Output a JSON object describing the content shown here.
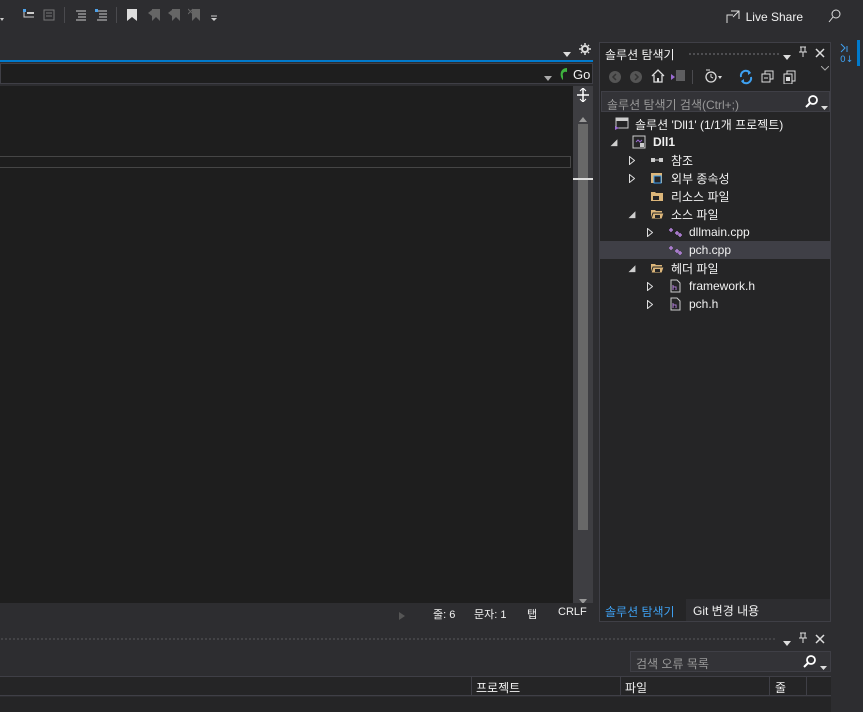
{
  "toolbar": {
    "live_share_label": "Live Share",
    "accent_color": "#007acc"
  },
  "editor": {
    "nav_go_label": "Go",
    "status": {
      "line": "줄: 6",
      "char": "문자: 1",
      "tab": "탭",
      "eol": "CRLF"
    }
  },
  "solution_explorer": {
    "title": "솔루션 탐색기",
    "search_placeholder": "솔루션 탐색기 검색(Ctrl+;)",
    "tree": [
      {
        "label": "솔루션 'Dll1' (1/1개 프로젝트)",
        "icon": "solution-icon",
        "expander": "none",
        "depth": 0
      },
      {
        "label": "Dll1",
        "icon": "project-icon",
        "expander": "expanded",
        "depth": 0
      },
      {
        "label": "참조",
        "icon": "references-icon",
        "expander": "collapsed",
        "depth": 1
      },
      {
        "label": "외부 종속성",
        "icon": "external-deps-icon",
        "expander": "collapsed",
        "depth": 1
      },
      {
        "label": "리소스 파일",
        "icon": "folder-icon",
        "expander": "none",
        "depth": 1
      },
      {
        "label": "소스 파일",
        "icon": "folder-open-icon",
        "expander": "expanded",
        "depth": 1
      },
      {
        "label": "dllmain.cpp",
        "icon": "cpp-file-icon",
        "expander": "collapsed",
        "depth": 2
      },
      {
        "label": "pch.cpp",
        "icon": "cpp-file-icon",
        "expander": "none",
        "depth": 2,
        "selected": true
      },
      {
        "label": "헤더 파일",
        "icon": "folder-open-icon",
        "expander": "expanded",
        "depth": 1
      },
      {
        "label": "framework.h",
        "icon": "header-file-icon",
        "expander": "collapsed",
        "depth": 2
      },
      {
        "label": "pch.h",
        "icon": "header-file-icon",
        "expander": "collapsed",
        "depth": 2
      }
    ],
    "tabs": {
      "solution_explorer": "솔루션 탐색기",
      "git_changes": "Git 변경 내용"
    }
  },
  "error_list": {
    "search_placeholder": "검색 오류 목록",
    "columns": {
      "project": "프로젝트",
      "file": "파일",
      "line": "줄"
    }
  }
}
